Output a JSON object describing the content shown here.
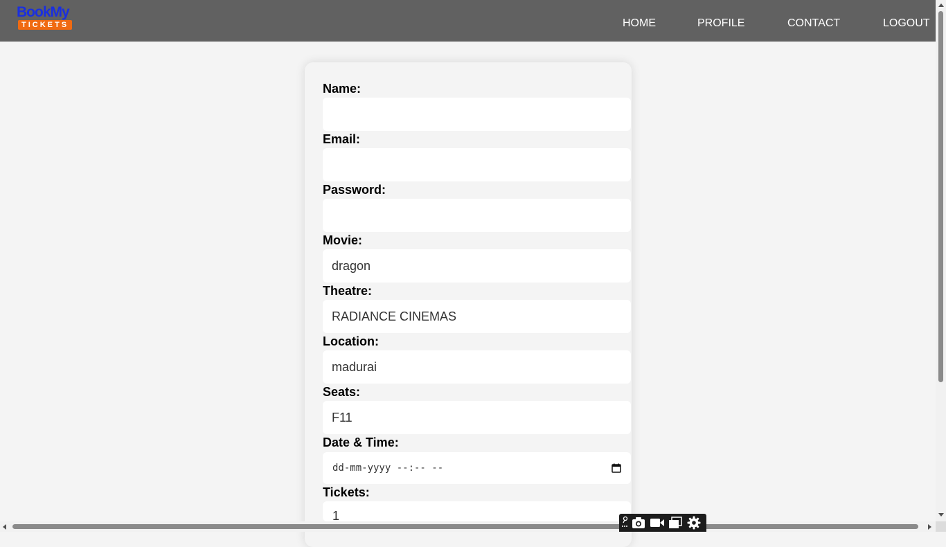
{
  "app": {
    "logo_top": "BookMy",
    "logo_bottom": "TICKETS"
  },
  "nav": {
    "home": "HOME",
    "profile": "PROFILE",
    "contact": "CONTACT",
    "logout": "LOGOUT"
  },
  "form": {
    "name_label": "Name:",
    "name_value": "",
    "email_label": "Email:",
    "email_value": "",
    "password_label": "Password:",
    "password_value": "",
    "movie_label": "Movie:",
    "movie_value": "dragon",
    "theatre_label": "Theatre:",
    "theatre_value": "RADIANCE CINEMAS",
    "location_label": "Location:",
    "location_value": "madurai",
    "seats_label": "Seats:",
    "seats_value": "F11",
    "datetime_label": "Date & Time:",
    "datetime_placeholder": "dd-mm-yyyy --:-- --",
    "tickets_label": "Tickets:",
    "tickets_value": "1"
  },
  "icons": {
    "calendar": "calendar-icon",
    "toolbar": [
      "pin-icon",
      "camera-icon",
      "video-icon",
      "window-icon",
      "gear-icon"
    ]
  },
  "colors": {
    "navbar": "#616161",
    "page_background": "#f4f4f4",
    "logo_blue": "#1a2fe0",
    "logo_orange": "#f06a12"
  }
}
